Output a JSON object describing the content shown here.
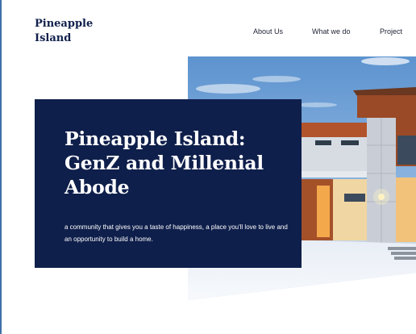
{
  "brand": {
    "name": "Pineapple Island"
  },
  "nav": {
    "items": [
      {
        "label": "About Us"
      },
      {
        "label": "What we do"
      },
      {
        "label": "Project"
      }
    ]
  },
  "hero": {
    "title": "Pineapple Island: GenZ and Millenial Abode",
    "description": "a community that gives you a taste of happiness, a place you'll love to live and an opportunity to build a home.",
    "image_icon": "modern-house-photo"
  },
  "colors": {
    "navy": "#0f1f4b",
    "text": "#1e2233",
    "sky": "#7fb0e0",
    "wood": "#a4512a",
    "warm_light": "#f0b25c"
  }
}
